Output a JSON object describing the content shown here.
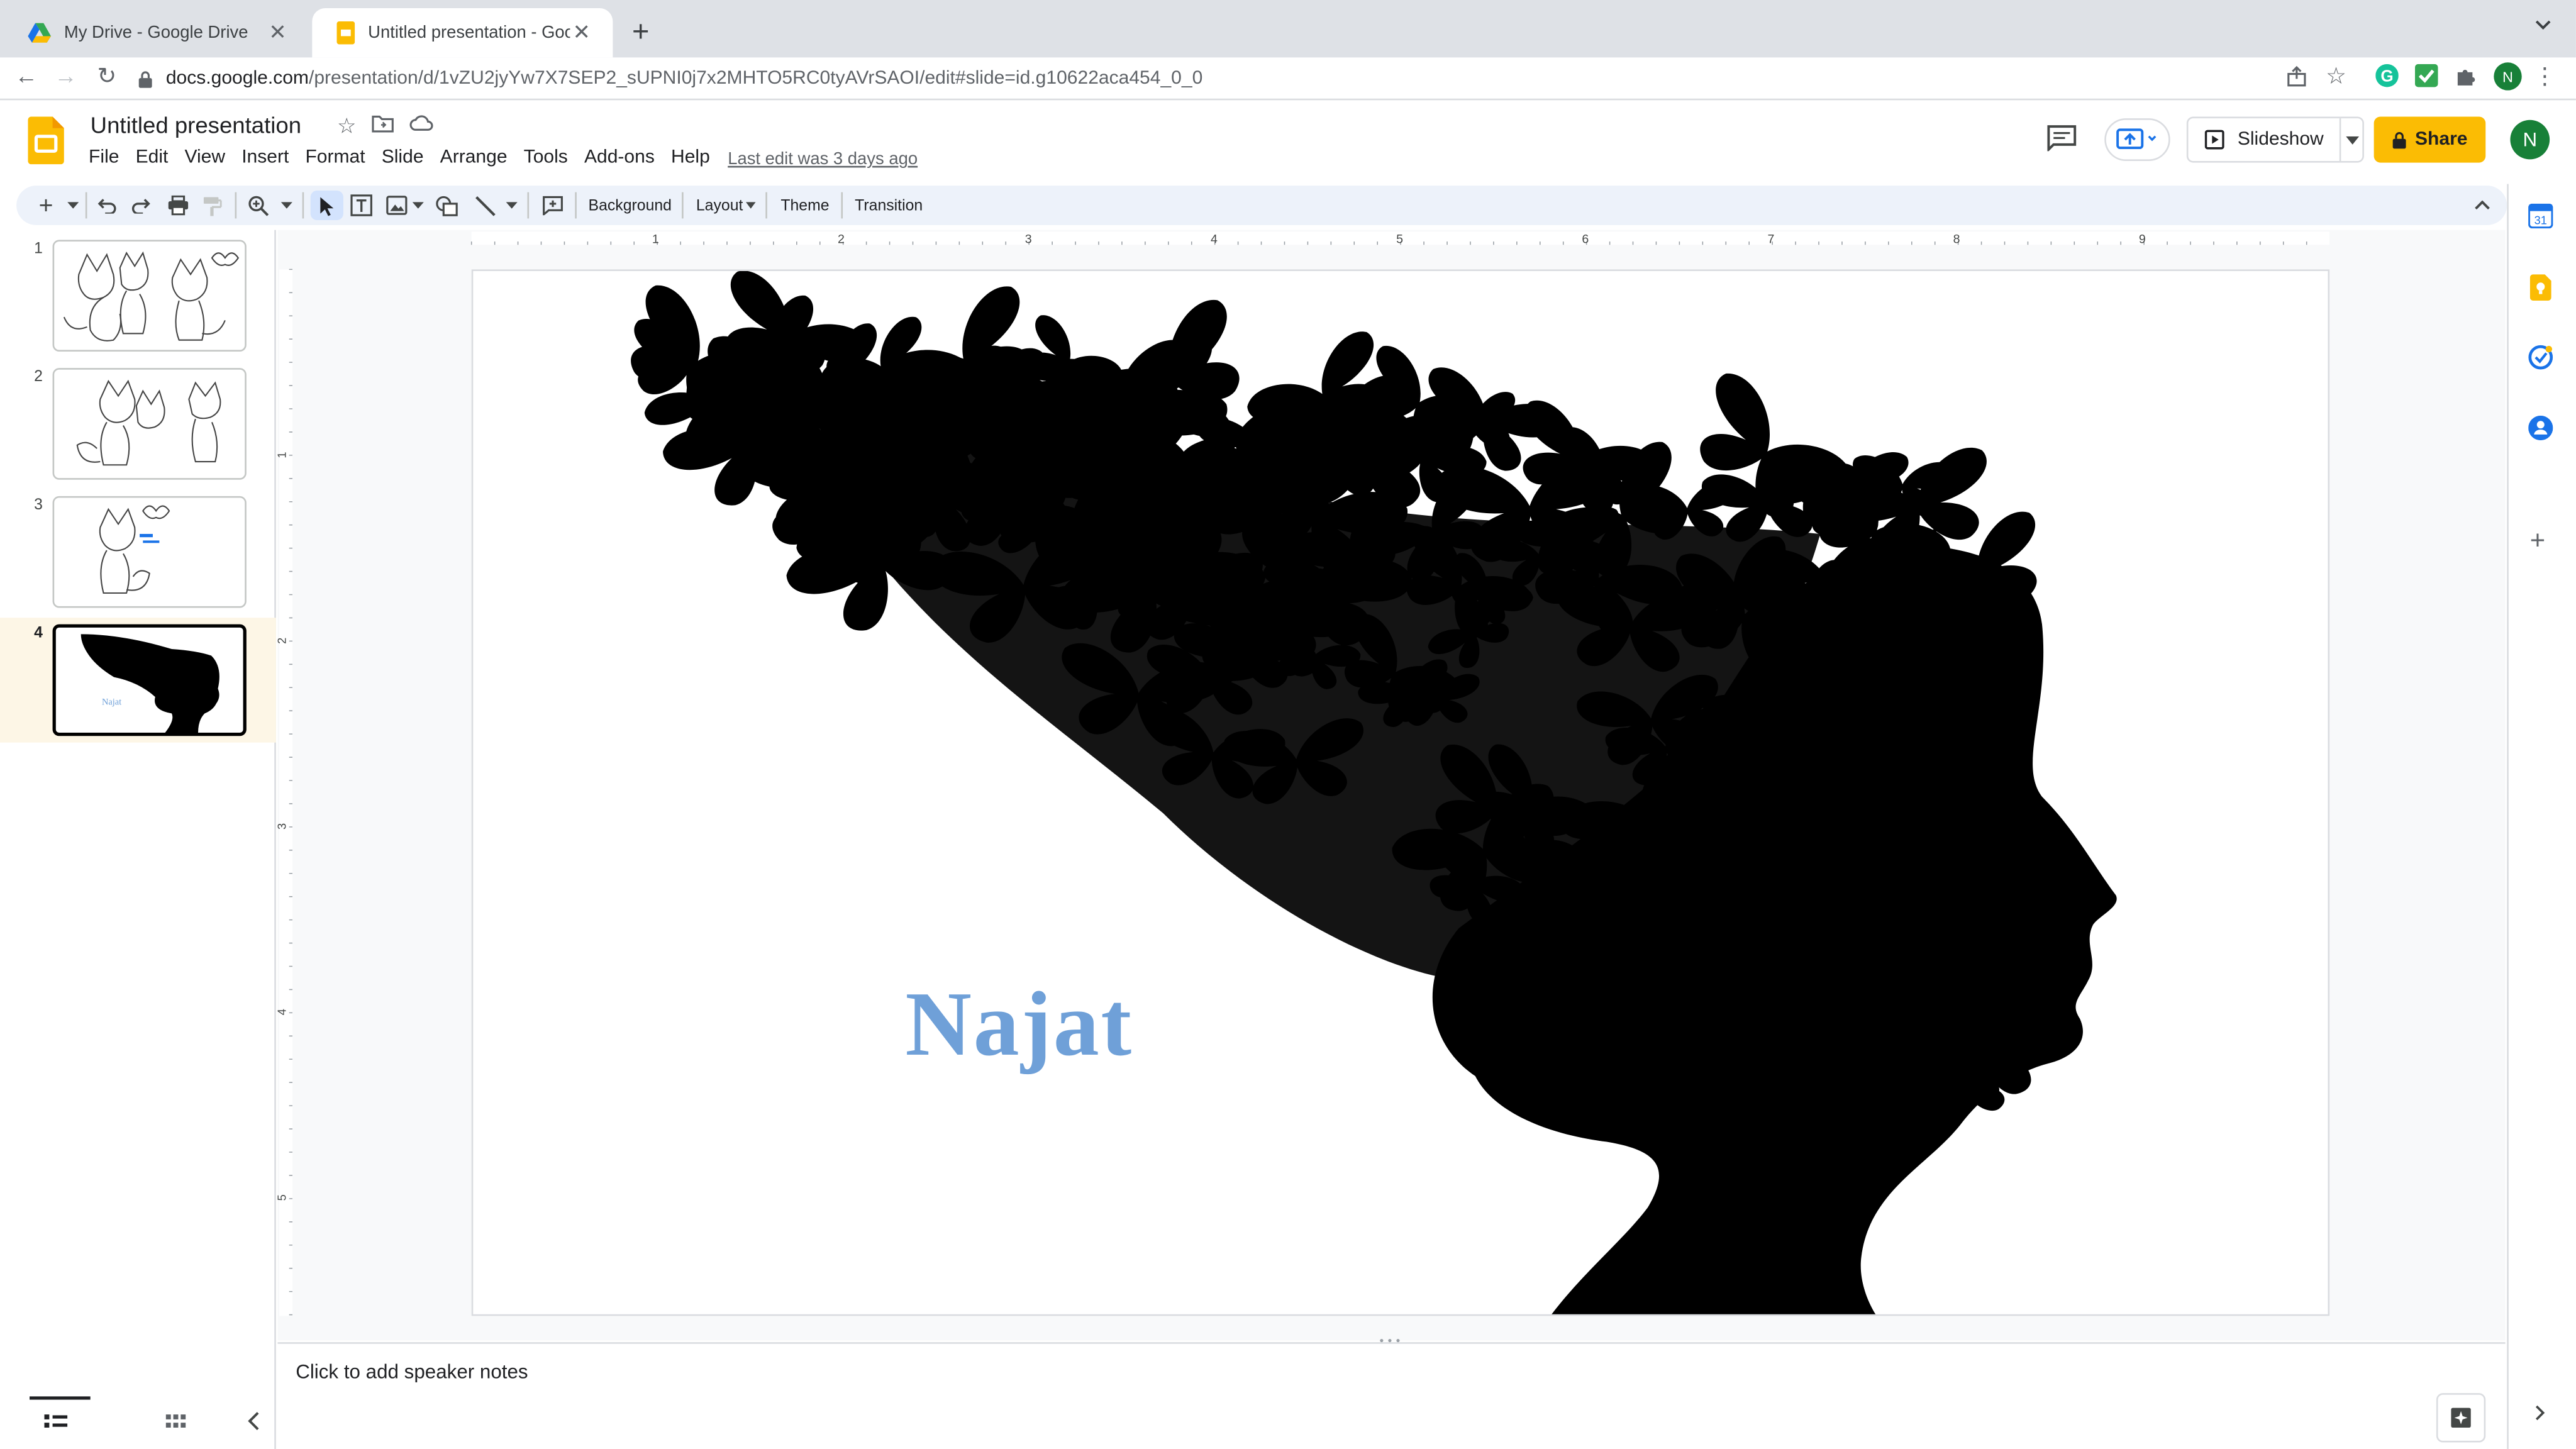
{
  "browser": {
    "tabs": [
      {
        "title": "My Drive - Google Drive",
        "icon": "google-drive-icon",
        "active": false
      },
      {
        "title": "Untitled presentation - Google Slides",
        "icon": "google-slides-icon",
        "active": true
      }
    ],
    "url_host": "docs.google.com",
    "url_path": "/presentation/d/1vZU2jyYw7X7SEP2_sUPNI0j7x2MHTO5RC0tyAVrSAOI/edit#slide=id.g10622aca454_0_0",
    "profile_initial": "N"
  },
  "doc": {
    "title": "Untitled presentation",
    "menu": [
      "File",
      "Edit",
      "View",
      "Insert",
      "Format",
      "Slide",
      "Arrange",
      "Tools",
      "Add-ons",
      "Help"
    ],
    "last_edit": "Last edit was 3 days ago",
    "slideshow_label": "Slideshow",
    "share_label": "Share",
    "user_initial": "N"
  },
  "toolbar": {
    "background_label": "Background",
    "layout_label": "Layout",
    "theme_label": "Theme",
    "transition_label": "Transition"
  },
  "ruler": {
    "h_numbers": [
      "1",
      "2",
      "3",
      "4",
      "5",
      "6",
      "7",
      "8",
      "9"
    ],
    "v_numbers": [
      "1",
      "2",
      "3",
      "4",
      "5"
    ]
  },
  "filmstrip": {
    "slides": [
      {
        "number": "1",
        "content": "fox-illustration"
      },
      {
        "number": "2",
        "content": "fox-illustration"
      },
      {
        "number": "3",
        "content": "fox-illustration-with-text"
      },
      {
        "number": "4",
        "content": "butterfly-head-silhouette",
        "caption": "Najat",
        "selected": true
      }
    ]
  },
  "slide": {
    "title_text": "Najat",
    "title_color": "#6fa0d8",
    "image": "woman-profile-silhouette-with-butterflies"
  },
  "notes": {
    "placeholder": "Click to add speaker notes"
  },
  "colors": {
    "share_button": "#fbbc04",
    "accent_blue": "#1a73e8",
    "selected_slide_band": "#fdf6e6"
  }
}
